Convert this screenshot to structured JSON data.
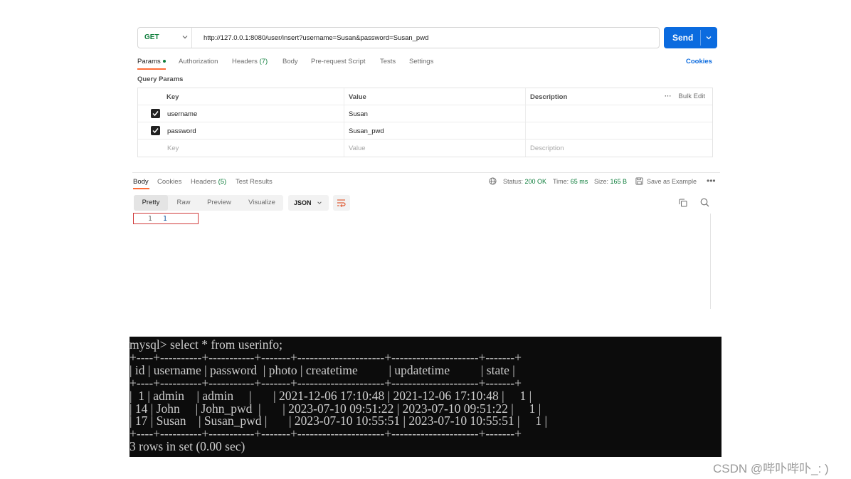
{
  "request": {
    "method": "GET",
    "url": "http://127.0.0.1:8080/user/insert?username=Susan&password=Susan_pwd",
    "send_label": "Send"
  },
  "request_tabs": {
    "params": "Params",
    "authorization": "Authorization",
    "headers": "Headers",
    "headers_count": "(7)",
    "body": "Body",
    "prerequest": "Pre-request Script",
    "tests": "Tests",
    "settings": "Settings",
    "cookies": "Cookies"
  },
  "query_params": {
    "title": "Query Params",
    "columns": {
      "key": "Key",
      "value": "Value",
      "description": "Description"
    },
    "bulk_edit": "Bulk Edit",
    "rows": [
      {
        "key": "username",
        "value": "Susan",
        "checked": true
      },
      {
        "key": "password",
        "value": "Susan_pwd",
        "checked": true
      }
    ],
    "placeholder": {
      "key": "Key",
      "value": "Value",
      "description": "Description"
    }
  },
  "response": {
    "tabs": {
      "body": "Body",
      "cookies": "Cookies",
      "headers": "Headers",
      "headers_count": "(5)",
      "test_results": "Test Results"
    },
    "status_label": "Status:",
    "status_value": "200 OK",
    "time_label": "Time:",
    "time_value": "65 ms",
    "size_label": "Size:",
    "size_value": "165 B",
    "save_example": "Save as Example",
    "views": {
      "pretty": "Pretty",
      "raw": "Raw",
      "preview": "Preview",
      "visualize": "Visualize"
    },
    "format": "JSON",
    "line_number": "1",
    "body_value": "1"
  },
  "terminal": {
    "prompt": "mysql> select * from userinfo;",
    "border": "+----+----------+-----------+-------+---------------------+---------------------+-------+",
    "header": "| id | username | password  | photo | createtime          | updatetime          | state |",
    "rows": [
      "|  1 | admin    | admin     |       | 2021-12-06 17:10:48 | 2021-12-06 17:10:48 |     1 |",
      "| 14 | John     | John_pwd  |       | 2023-07-10 09:51:22 | 2023-07-10 09:51:22 |     1 |",
      "| 17 | Susan    | Susan_pwd |       | 2023-07-10 10:55:51 | 2023-07-10 10:55:51 |     1 |"
    ],
    "footer": "3 rows in set (0.00 sec)"
  },
  "watermark": "CSDN @哔卟哔卟_: )"
}
